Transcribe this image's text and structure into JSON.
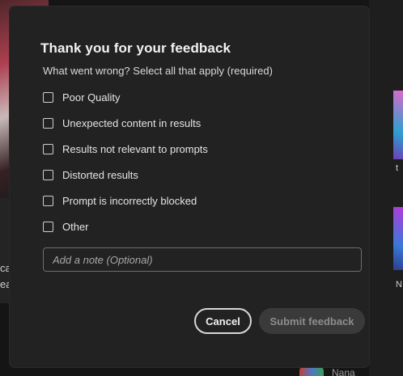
{
  "background": {
    "left_text_1": "ca",
    "left_text_2": "ea",
    "right_text_1": "t",
    "right_text_2": "N",
    "bottom_text": "Nana"
  },
  "dialog": {
    "title": "Thank you for your feedback",
    "subtitle": "What went wrong? Select all that apply (required)",
    "options": [
      {
        "label": "Poor Quality",
        "checked": false
      },
      {
        "label": "Unexpected content in results",
        "checked": false
      },
      {
        "label": "Results not relevant to prompts",
        "checked": false
      },
      {
        "label": "Distorted results",
        "checked": false
      },
      {
        "label": "Prompt is incorrectly blocked",
        "checked": false
      },
      {
        "label": "Other",
        "checked": false
      }
    ],
    "note": {
      "value": "",
      "placeholder": "Add a note (Optional)"
    },
    "cancel_label": "Cancel",
    "submit_label": "Submit feedback",
    "submit_enabled": false
  },
  "colors": {
    "dialog_bg": "#222222",
    "text_primary": "#f2f2f2",
    "submit_disabled_bg": "#3a3a3a",
    "submit_disabled_text": "#8d8d8d"
  }
}
